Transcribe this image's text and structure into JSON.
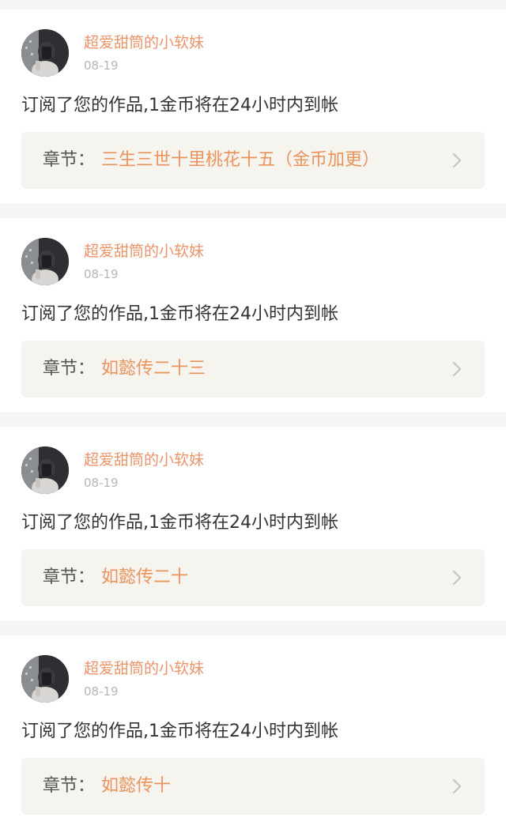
{
  "notifications": [
    {
      "user_name": "超爱甜筒的小软妹",
      "date": "08-19",
      "message": "订阅了您的作品,1金币将在24小时内到帐",
      "chapter_prefix": "章节：",
      "chapter_title": "三生三世十里桃花十五（金币加更）"
    },
    {
      "user_name": "超爱甜筒的小软妹",
      "date": "08-19",
      "message": "订阅了您的作品,1金币将在24小时内到帐",
      "chapter_prefix": "章节：",
      "chapter_title": "如懿传二十三"
    },
    {
      "user_name": "超爱甜筒的小软妹",
      "date": "08-19",
      "message": "订阅了您的作品,1金币将在24小时内到帐",
      "chapter_prefix": "章节：",
      "chapter_title": "如懿传二十"
    },
    {
      "user_name": "超爱甜筒的小软妹",
      "date": "08-19",
      "message": "订阅了您的作品,1金币将在24小时内到帐",
      "chapter_prefix": "章节：",
      "chapter_title": "如懿传十"
    }
  ],
  "colors": {
    "page_background": "#f6f4f4",
    "card_background": "#ffffff",
    "user_name": "#e8956a",
    "date": "#b7b7b7",
    "message": "#333333",
    "chapter_box": "#f5f4ef",
    "chapter_title": "#eb935c"
  },
  "icons": {
    "avatar": "user-avatar-photo",
    "chevron": "chevron-right-icon"
  }
}
